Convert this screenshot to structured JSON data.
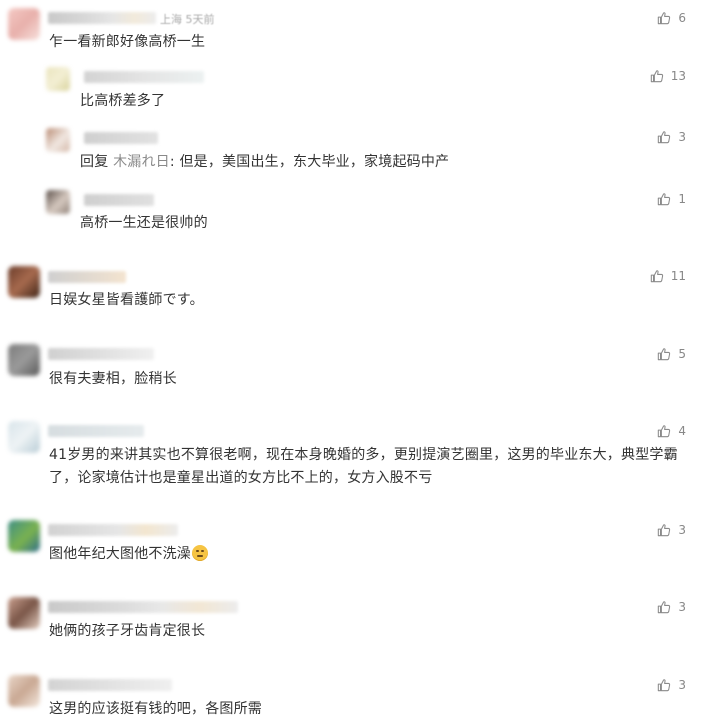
{
  "comments": [
    {
      "meta": "上海 5天前",
      "text": "乍一看新郎好像高桥一生",
      "likes": "6",
      "avatar": [
        "#f4c9c4",
        "#e8b0ab",
        "#f7e0dc"
      ]
    },
    {
      "text": "比高桥差多了",
      "likes": "13",
      "avatar": [
        "#eae4bd",
        "#f3efd4",
        "#d9d39c"
      ]
    },
    {
      "reply_prefix": "回复 ",
      "reply_name": "木漏れ日",
      "reply_rest": ": 但是，美国出生，东大毕业，家境起码中产",
      "likes": "3",
      "avatar": [
        "#b88a72",
        "#f1e8e2",
        "#d4b7a7"
      ]
    },
    {
      "text": "高桥一生还是很帅的",
      "likes": "1",
      "avatar": [
        "#5a4e48",
        "#d6c9c0",
        "#8f8178"
      ]
    },
    {
      "text": "日娱女星皆看護師です。",
      "likes": "11",
      "avatar": [
        "#6a3c2a",
        "#a76a4e",
        "#3e2417"
      ]
    },
    {
      "text": "很有夫妻相，脸稍长",
      "likes": "5",
      "avatar": [
        "#7c7c7c",
        "#9a9a9a",
        "#5a5a5a"
      ]
    },
    {
      "text": "41岁男的来讲其实也不算很老啊，现在本身晚婚的多，更别提演艺圈里，这男的毕业东大，典型学霸了，论家境估计也是童星出道的女方比不上的，女方入股不亏",
      "likes": "4",
      "avatar": [
        "#d8e4ea",
        "#eef3f5",
        "#b9cdd6"
      ]
    },
    {
      "text": "图他年纪大图他不洗澡",
      "likes": "3",
      "avatar": [
        "#3f8f86",
        "#7ab24f",
        "#2f6e8c"
      ]
    },
    {
      "text": "她俩的孩子牙齿肯定很长",
      "likes": "3",
      "avatar": [
        "#caa08f",
        "#7a5648",
        "#e3cdbf"
      ]
    },
    {
      "text": "这男的应该挺有钱的吧，各图所需",
      "likes": "3",
      "avatar": [
        "#e9d6c8",
        "#c9a893",
        "#f4e8de"
      ]
    }
  ]
}
